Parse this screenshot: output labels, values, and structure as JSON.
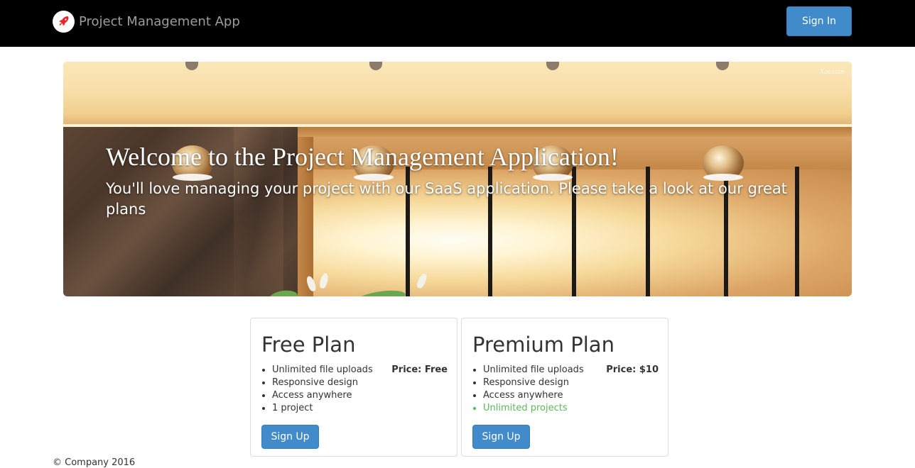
{
  "navbar": {
    "brand": "Project Management App",
    "logo_icon": "rocket-icon",
    "signin_label": "Sign In"
  },
  "hero": {
    "title": "Welcome to the Project Management Application!",
    "subtitle": "You'll love managing your project with our SaaS application. Please take a look at our great plans",
    "watermark": "Xᴅᴇsɪɢɴ"
  },
  "plans": [
    {
      "title": "Free Plan",
      "price": "Price: Free",
      "features": [
        "Unlimited file uploads",
        "Responsive design",
        "Access anywhere",
        "1 project"
      ],
      "signup_label": "Sign Up"
    },
    {
      "title": "Premium Plan",
      "price": "Price: $10",
      "features": [
        "Unlimited file uploads",
        "Responsive design",
        "Access anywhere",
        "Unlimited projects"
      ],
      "signup_label": "Sign Up"
    }
  ],
  "footer": {
    "copyright": "© Company 2016"
  },
  "colors": {
    "primary": "#428bca",
    "highlight": "#5cb85c",
    "navbar": "#000000",
    "brand_text": "#9d9d9d"
  }
}
